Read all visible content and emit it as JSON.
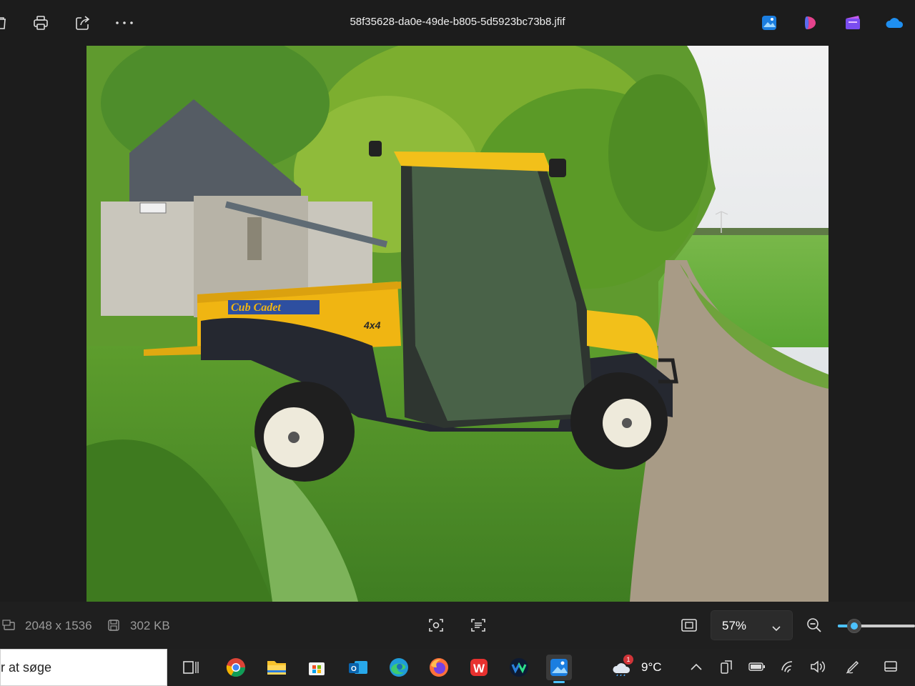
{
  "window": {
    "filename": "58f35628-da0e-49de-b805-5d5923bc73b8.jfif"
  },
  "toolbar": {
    "icons": [
      "delete-icon",
      "print-icon",
      "share-icon",
      "more-icon"
    ],
    "app_icons": [
      "photos-app-icon",
      "copilot-icon",
      "clipchamp-icon",
      "onedrive-icon"
    ]
  },
  "photo": {
    "description_colors": {
      "sky": "#dfe3e6",
      "grass": "#5c9a2e",
      "vehicle": "#f3b814"
    },
    "vehicle_brand_text": "Cub Cadet",
    "vehicle_badge_text": "4x4"
  },
  "infobar": {
    "dimensions": "2048 x 1536",
    "file_size": "302 KB",
    "zoom": "57%",
    "zoom_level": 0.57
  },
  "taskbar": {
    "search_text": "r at søge",
    "apps": [
      "task-view-icon",
      "chrome-icon",
      "file-explorer-icon",
      "store-icon",
      "outlook-icon",
      "edge-icon",
      "firefox-icon",
      "wps-icon",
      "webex-icon",
      "photos-icon"
    ],
    "weather": {
      "temp": "9°C",
      "badge": "1"
    }
  },
  "colors": {
    "accent": "#4cc2ff",
    "bg": "#1c1c1c"
  }
}
